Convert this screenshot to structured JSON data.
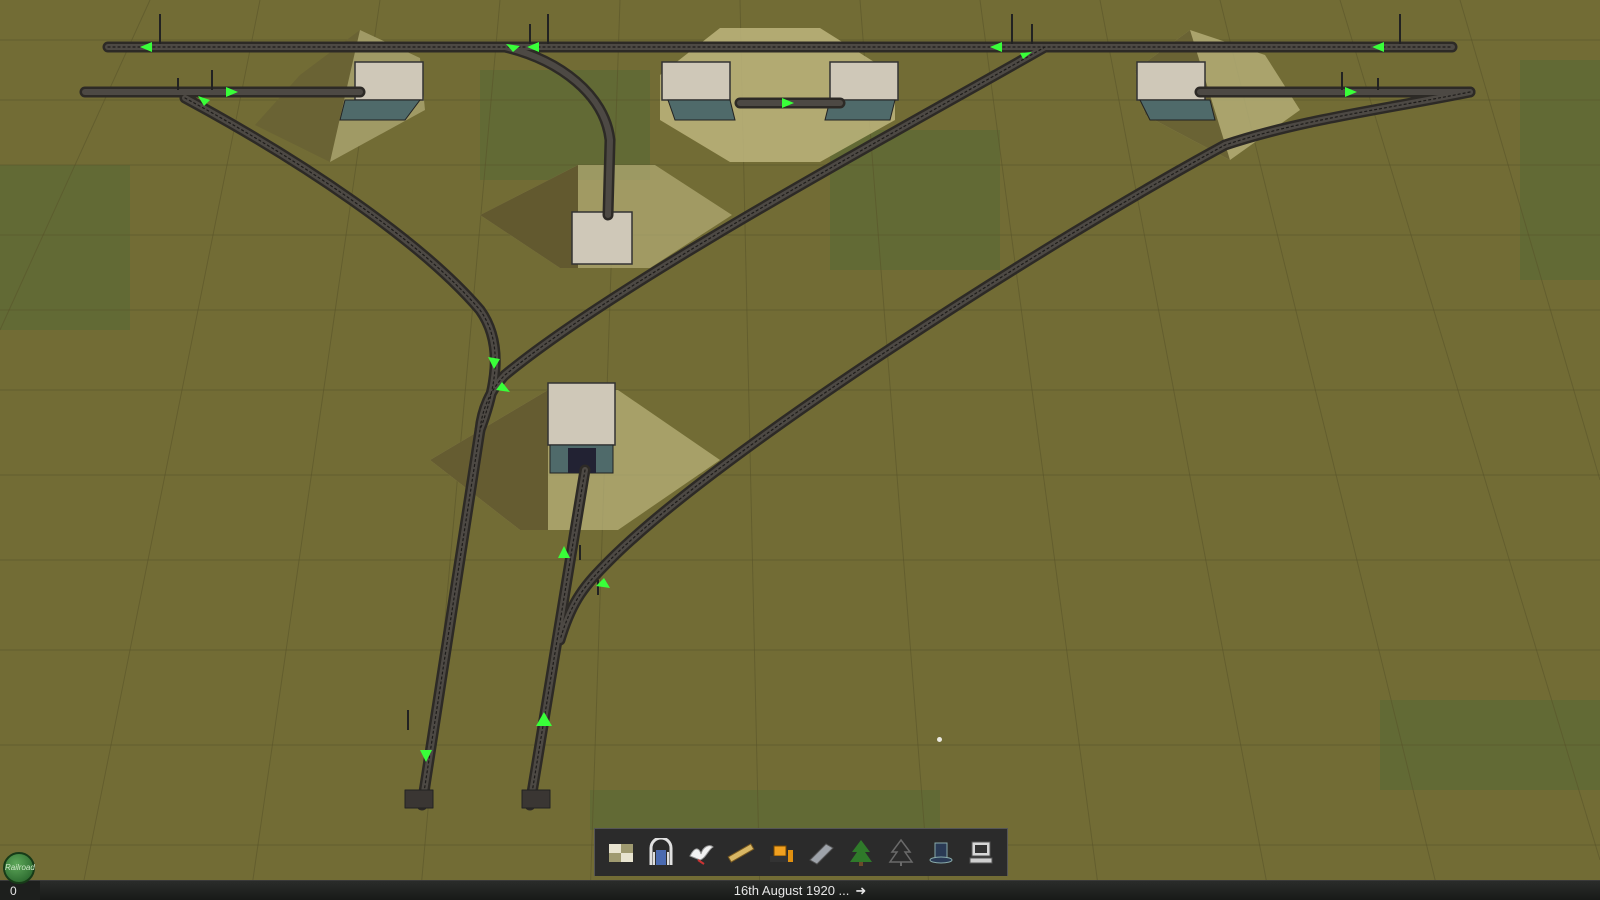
{
  "status_bar": {
    "date": "16th August 1920 ...",
    "next_arrow": "➜",
    "money": "0"
  },
  "logo": {
    "label": "Railroad"
  },
  "toolbar": {
    "tools": [
      {
        "name": "terrain-tool",
        "icon": "terrain-tiles-icon"
      },
      {
        "name": "track-tool",
        "icon": "track-arch-icon"
      },
      {
        "name": "trackside-tool",
        "icon": "bird-icon"
      },
      {
        "name": "measure-tool",
        "icon": "ruler-icon"
      },
      {
        "name": "bulldozer-tool",
        "icon": "bulldozer-icon"
      },
      {
        "name": "paint-tool",
        "icon": "paint-plank-icon"
      },
      {
        "name": "scenery-tool",
        "icon": "tree-icon"
      },
      {
        "name": "scenery-delete-tool",
        "icon": "tree-outline-icon"
      },
      {
        "name": "objects-tool",
        "icon": "top-hat-icon"
      },
      {
        "name": "settings-tool",
        "icon": "computer-icon"
      }
    ]
  },
  "colors": {
    "grass": "#726c35",
    "grass_dark": "#5f6a35",
    "track": "#3b3834",
    "arrow": "#39ff39",
    "tunnel_roof": "#c9c3b4",
    "toolbar": "#2b2b2b"
  }
}
